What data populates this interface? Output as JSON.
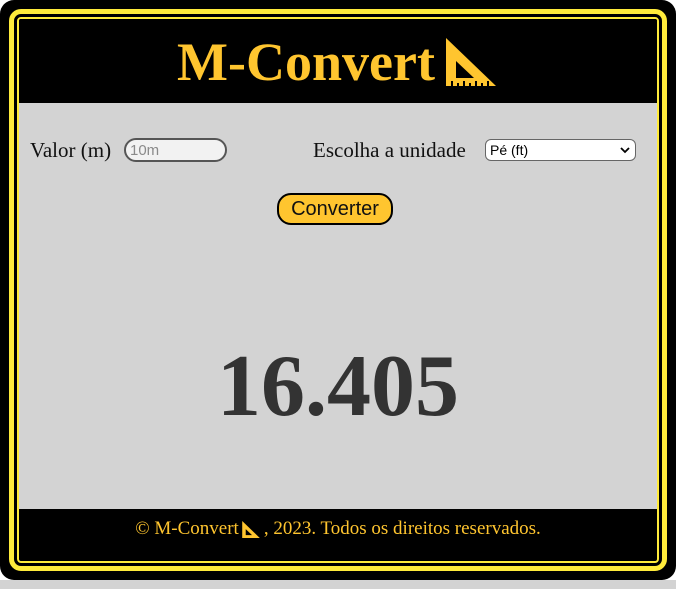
{
  "header": {
    "title": "M-Convert",
    "icon": "triangular-ruler-icon"
  },
  "form": {
    "value_label": "Valor (m)",
    "value_placeholder": "10m",
    "unit_label": "Escolha a unidade",
    "unit_selected": "Pé (ft)",
    "convert_label": "Converter"
  },
  "result": {
    "value": "16.405"
  },
  "footer": {
    "prefix": "© M-Convert",
    "suffix": ", 2023. Todos os direitos reservados."
  },
  "colors": {
    "accent": "#ffc52f",
    "frame": "#ffeb3b",
    "background": "#d3d3d3",
    "bar": "#000000"
  }
}
